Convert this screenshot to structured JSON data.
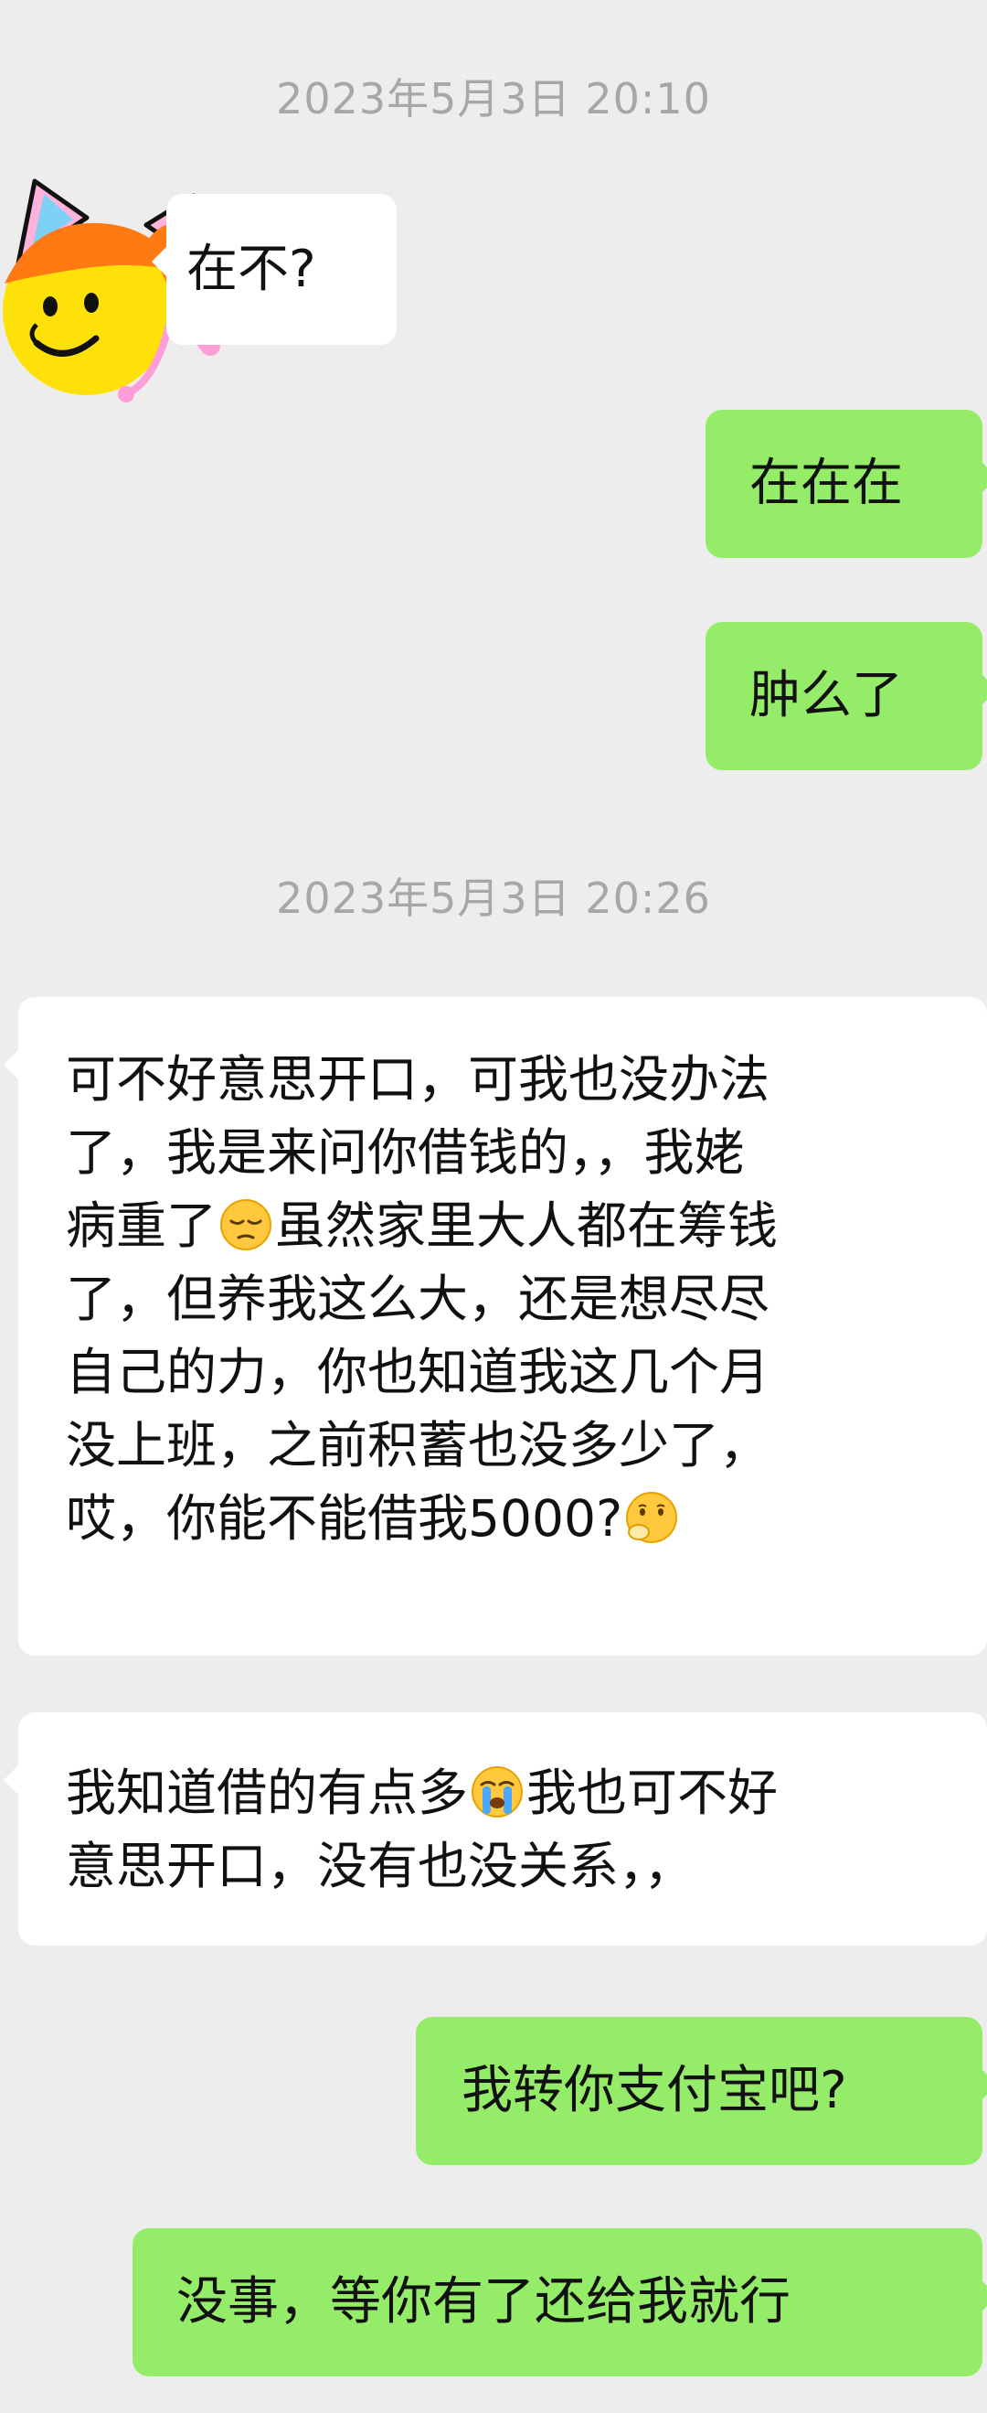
{
  "timestamps": [
    "2023年5月3日 20:10",
    "2023年5月3日 20:26"
  ],
  "messages": [
    {
      "side": "left",
      "text": "在不?"
    },
    {
      "side": "right",
      "text": "在在在"
    },
    {
      "side": "right",
      "text": "肿么了"
    },
    {
      "side": "left",
      "lines": [
        "可不好意思开口，可我也没办法",
        "了，我是来问你借钱的，，我姥",
        "病重了",
        "虽然家里大人都在筹钱",
        "了，但养我这么大，还是想尽尽",
        "自己的力，你也知道我这几个月",
        "没上班，之前积蓄也没多少了，",
        "哎，你能不能借我5000?"
      ]
    },
    {
      "side": "left",
      "lines": [
        "我知道借的有点多",
        "我也可不好",
        "意思开口，没有也没关系，，"
      ]
    },
    {
      "side": "right",
      "text": "我转你支付宝吧?"
    },
    {
      "side": "right",
      "text": "没事，等你有了还给我就行"
    }
  ],
  "emojis": [
    "pensive-face-emoji",
    "face-with-hand-over-mouth-emoji",
    "loudly-crying-face-emoji"
  ],
  "colors": {
    "background": "#ededed",
    "bubble_left": "#ffffff",
    "bubble_right": "#95ec69",
    "timestamp": "#a7a7a7",
    "text": "#111111"
  }
}
